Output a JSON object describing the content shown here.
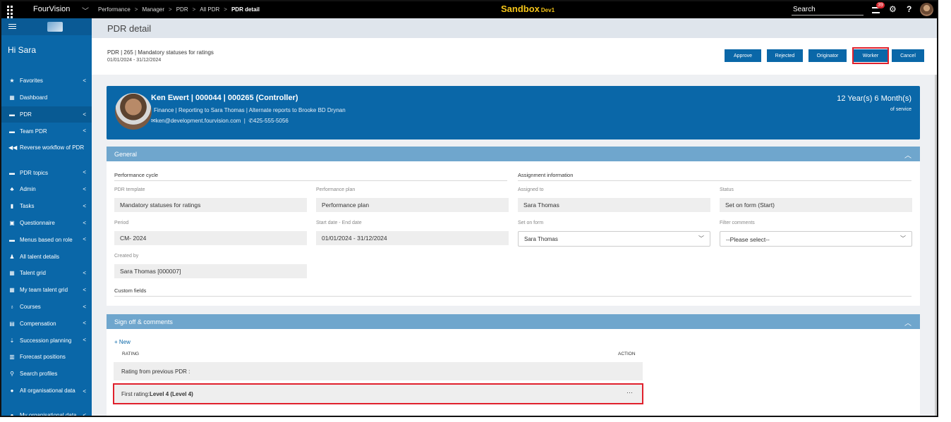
{
  "topbar": {
    "brand": "FourVision",
    "breadcrumbs": [
      "Performance",
      "Manager",
      "PDR",
      "All PDR"
    ],
    "current_crumb": "PDR detail",
    "sandbox": "Sandbox",
    "sandbox_tag": "Dev1",
    "search_placeholder": "Search",
    "notification_count": "39",
    "help": "?"
  },
  "sidebar": {
    "greeting": "Hi Sara",
    "items": [
      {
        "label": "Favorites",
        "icon": "star-icon",
        "chev": true
      },
      {
        "label": "Dashboard",
        "icon": "dashboard-icon",
        "chev": false
      },
      {
        "label": "PDR",
        "icon": "folder-icon",
        "chev": true,
        "active": true
      },
      {
        "label": "Team PDR",
        "icon": "folder-icon",
        "chev": true
      },
      {
        "label": "Reverse workflow of PDR",
        "icon": "rewind-icon",
        "chev": false
      },
      {
        "label": "PDR topics",
        "icon": "folder-icon",
        "chev": true
      },
      {
        "label": "Admin",
        "icon": "users-gear-icon",
        "chev": true
      },
      {
        "label": "Tasks",
        "icon": "clipboard-icon",
        "chev": true
      },
      {
        "label": "Questionnaire",
        "icon": "form-icon",
        "chev": true
      },
      {
        "label": "Menus based on role",
        "icon": "folder-icon",
        "chev": true
      },
      {
        "label": "All talent details",
        "icon": "people-icon",
        "chev": false
      },
      {
        "label": "Talent grid",
        "icon": "grid-icon",
        "chev": true
      },
      {
        "label": "My team talent grid",
        "icon": "grid-icon",
        "chev": true
      },
      {
        "label": "Courses",
        "icon": "courses-icon",
        "chev": true
      },
      {
        "label": "Compensation",
        "icon": "money-icon",
        "chev": true
      },
      {
        "label": "Succession planning",
        "icon": "succession-icon",
        "chev": true
      },
      {
        "label": "Forecast positions",
        "icon": "forecast-icon",
        "chev": false
      },
      {
        "label": "Search profiles",
        "icon": "search-icon",
        "chev": false
      },
      {
        "label": "All organisational data",
        "icon": "globe-icon",
        "chev": true
      },
      {
        "label": "My organisational data",
        "icon": "globe-icon",
        "chev": true
      }
    ]
  },
  "page": {
    "title": "PDR detail",
    "header_line1": "PDR | 265 | Mandatory statuses for ratings",
    "header_line2": "01/01/2024 - 31/12/2024",
    "buttons": {
      "approve": "Approve",
      "rejected": "Rejected",
      "originator": "Originator",
      "worker": "Worker",
      "cancel": "Cancel"
    }
  },
  "profile": {
    "name": "Ken Ewert | 000044 | 000265 (Controller)",
    "line2": "Finance   |   Reporting to Sara Thomas   |   Alternate reports to Brooke BD Drynan",
    "email": "ken@development.fourvision.com",
    "phone": "425-555-5056",
    "service": "12 Year(s) 6 Month(s)",
    "service_sub": "of service"
  },
  "general": {
    "title": "General",
    "perf_cycle_title": "Performance cycle",
    "assign_title": "Assignment information",
    "pdr_template_label": "PDR template",
    "pdr_template_value": "Mandatory statuses for ratings",
    "perf_plan_label": "Performance plan",
    "perf_plan_value": "Performance plan",
    "assigned_to_label": "Assigned to",
    "assigned_to_value": "Sara Thomas",
    "status_label": "Status",
    "status_value": "Set on form (Start)",
    "period_label": "Period",
    "period_value": "CM- 2024",
    "dates_label": "Start date - End date",
    "dates_value": "01/01/2024 - 31/12/2024",
    "set_on_form_label": "Set on form",
    "set_on_form_value": "Sara Thomas",
    "filter_label": "Filter comments",
    "filter_value": "--Please select--",
    "created_by_label": "Created by",
    "created_by_value": "Sara Thomas [000007]",
    "custom_fields": "Custom fields"
  },
  "signoff": {
    "title": "Sign off & comments",
    "new_link": "+ New",
    "col_rating": "RATING",
    "col_action": "ACTION",
    "row1": "Rating from previous PDR :",
    "row2_prefix": "First rating: ",
    "row2_value": "Level 4 (Level 4)",
    "row2_action": "···"
  },
  "colors": {
    "primary": "#0a67a8",
    "panel_header": "#6fa6cd",
    "highlight": "#e0202c",
    "sandbox": "#f5c518"
  }
}
